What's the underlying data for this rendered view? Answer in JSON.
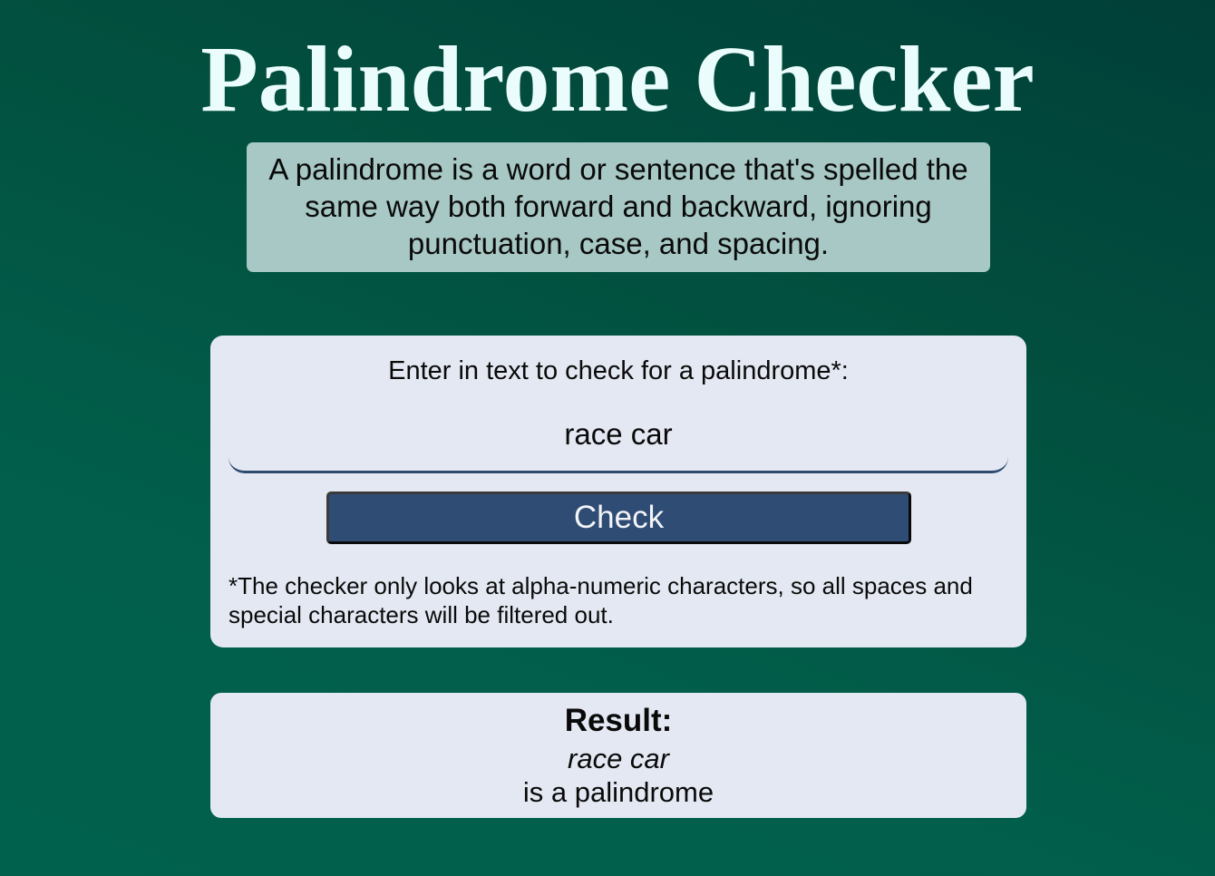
{
  "header": {
    "title": "Palindrome Checker"
  },
  "description": {
    "text": "A palindrome is a word or sentence that's spelled the same way both forward and backward, ignoring punctuation, case, and spacing."
  },
  "checker": {
    "label": "Enter in text to check for a palindrome*:",
    "input_value": "race car",
    "button_label": "Check",
    "footnote": "*The checker only looks at alpha-numeric characters, so all spaces and special characters will be filtered out."
  },
  "result": {
    "title": "Result:",
    "checked_text": "race car",
    "verdict": "is a palindrome"
  },
  "colors": {
    "background_top": "#003f38",
    "background_bottom": "#00614c",
    "title_text": "#eafcfc",
    "description_bg": "#a7c8c4",
    "card_bg": "#e3e8f2",
    "button_bg": "#2f4c74",
    "input_underline": "#2e4a70"
  }
}
